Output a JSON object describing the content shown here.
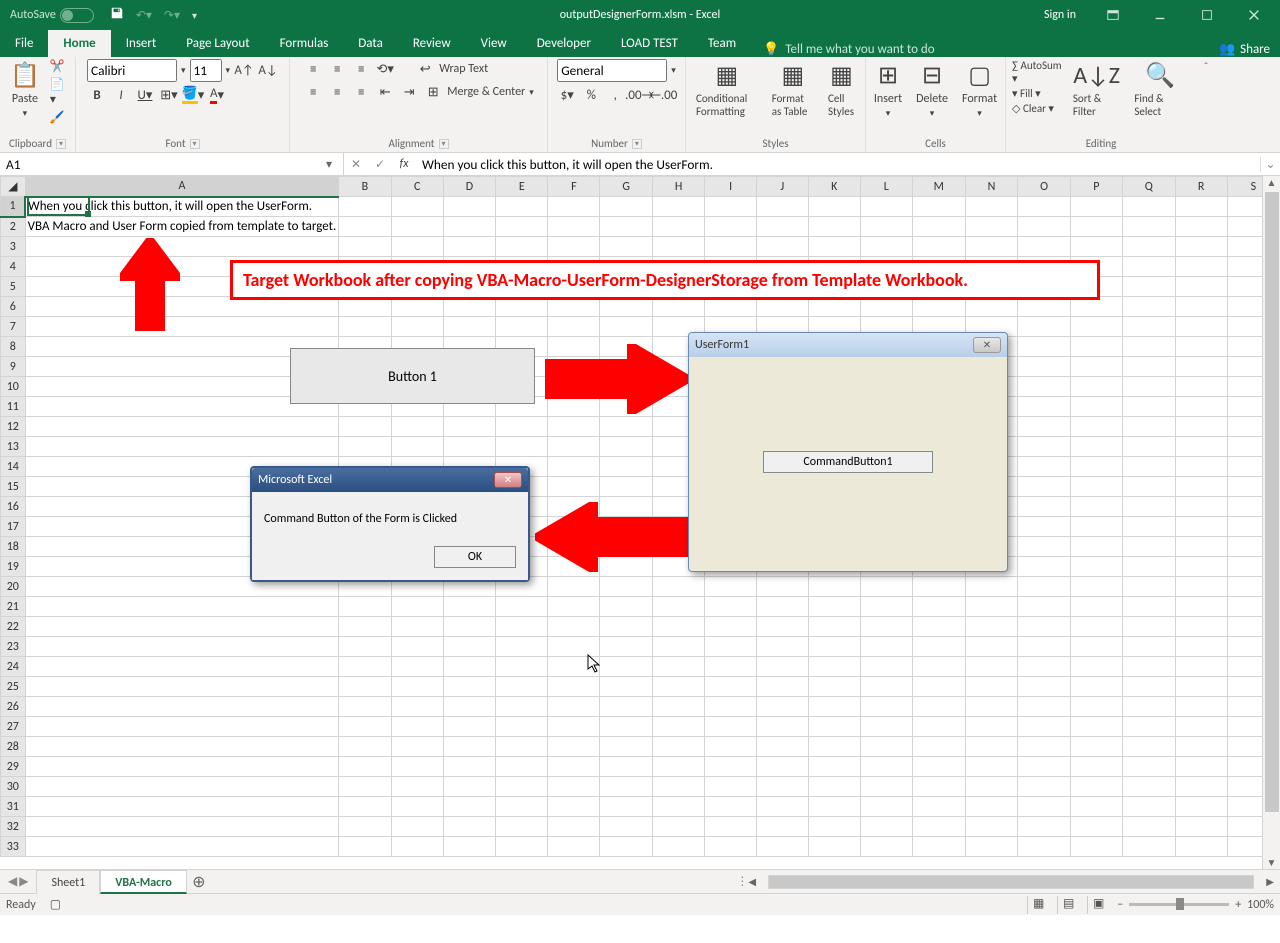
{
  "titlebar": {
    "autosave": "AutoSave",
    "doc": "outputDesignerForm.xlsm - Excel",
    "signin": "Sign in"
  },
  "tabs": {
    "file": "File",
    "home": "Home",
    "insert": "Insert",
    "pagelayout": "Page Layout",
    "formulas": "Formulas",
    "data": "Data",
    "review": "Review",
    "view": "View",
    "developer": "Developer",
    "loadtest": "LOAD TEST",
    "team": "Team",
    "tell": "Tell me what you want to do",
    "share": "Share"
  },
  "ribbon": {
    "clipboard": {
      "label": "Clipboard",
      "paste": "Paste"
    },
    "font": {
      "label": "Font",
      "name": "Calibri",
      "size": "11"
    },
    "alignment": {
      "label": "Alignment",
      "wrap": "Wrap Text",
      "merge": "Merge & Center"
    },
    "number": {
      "label": "Number",
      "format": "General"
    },
    "styles": {
      "label": "Styles",
      "cond": "Conditional Formatting",
      "table": "Format as Table",
      "cell": "Cell Styles"
    },
    "cells": {
      "label": "Cells",
      "insert": "Insert",
      "delete": "Delete",
      "format": "Format"
    },
    "editing": {
      "label": "Editing",
      "autosum": "AutoSum",
      "fill": "Fill",
      "clear": "Clear",
      "sort": "Sort & Filter",
      "find": "Find & Select"
    }
  },
  "formula": {
    "namebox": "A1",
    "formula": "When you click this button, it will open the UserForm."
  },
  "grid": {
    "cols": [
      "A",
      "B",
      "C",
      "D",
      "E",
      "F",
      "G",
      "H",
      "I",
      "J",
      "K",
      "L",
      "M",
      "N",
      "O",
      "P",
      "Q",
      "R",
      "S"
    ],
    "row1": "When you click this button, it will open the UserForm.",
    "row2": "VBA Macro and User Form copied from template to target."
  },
  "annotation": {
    "text": "Target Workbook after copying VBA-Macro-UserForm-DesignerStorage from Template Workbook."
  },
  "button1": {
    "label": "Button 1"
  },
  "userform": {
    "title": "UserForm1",
    "cmd": "CommandButton1"
  },
  "msgbox": {
    "title": "Microsoft Excel",
    "body": "Command Button of the Form is Clicked",
    "ok": "OK"
  },
  "sheets": {
    "s1": "Sheet1",
    "s2": "VBA-Macro"
  },
  "statusbar": {
    "ready": "Ready",
    "zoom": "100%"
  }
}
